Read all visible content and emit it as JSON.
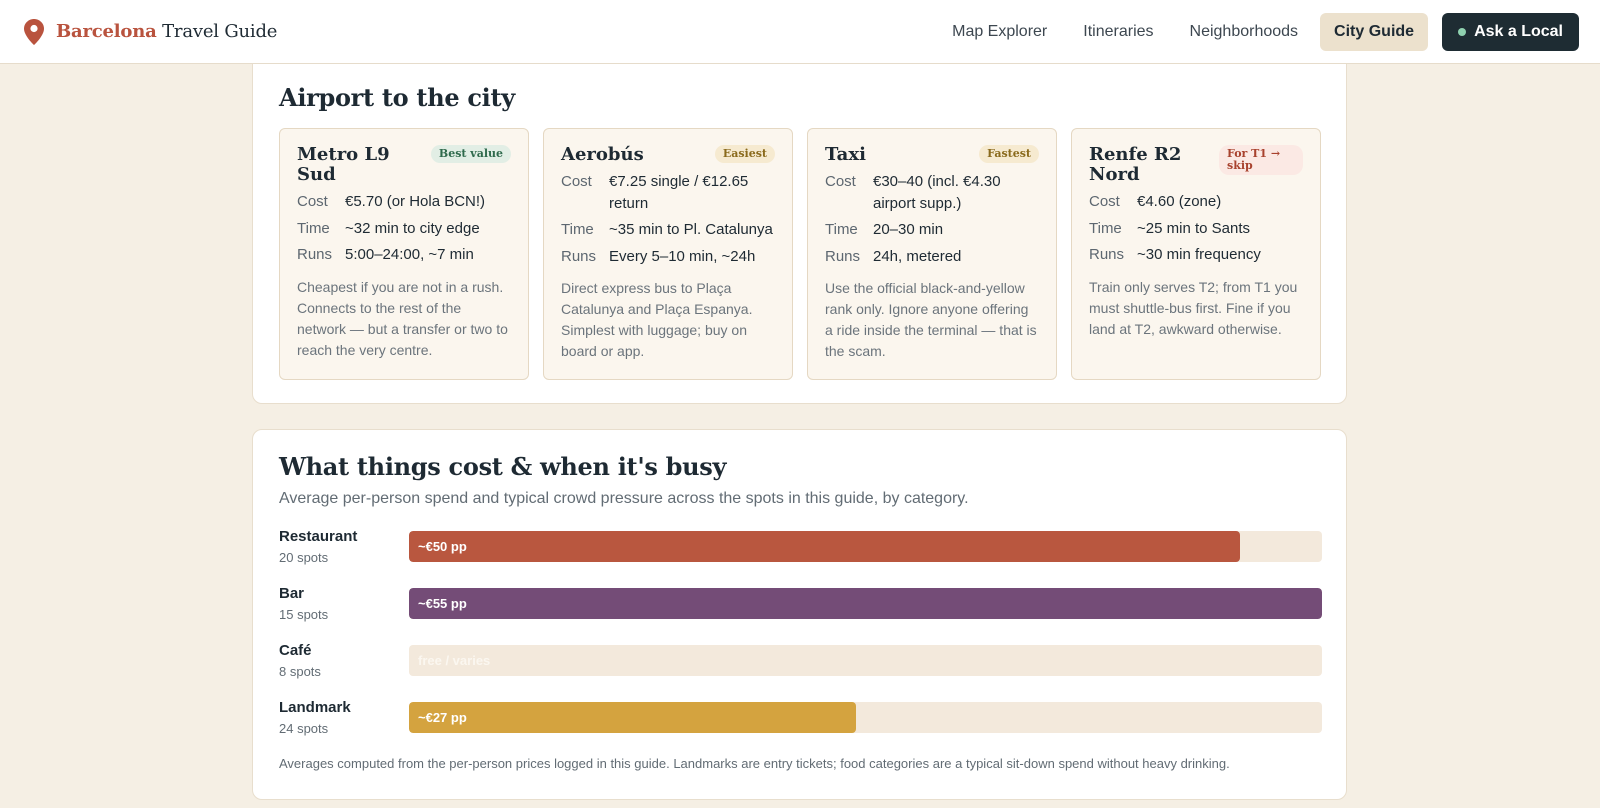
{
  "brand": {
    "accent": "Barcelona",
    "rest": "Travel Guide"
  },
  "nav": {
    "items": [
      {
        "label": "Map Explorer",
        "active": false
      },
      {
        "label": "Itineraries",
        "active": false
      },
      {
        "label": "Neighborhoods",
        "active": false
      },
      {
        "label": "City Guide",
        "active": true
      }
    ],
    "cta": "Ask a Local"
  },
  "airport": {
    "title": "Airport to the city",
    "options": [
      {
        "name": "Metro L9 Sud",
        "badge": "Best value",
        "rows": [
          {
            "key": "Cost",
            "value": "€5.70 (or Hola BCN!)"
          },
          {
            "key": "Time",
            "value": "~32 min to city edge"
          },
          {
            "key": "Runs",
            "value": "5:00–24:00, ~7 min"
          }
        ],
        "desc": "Cheapest if you are not in a rush. Connects to the rest of the network — but a transfer or two to reach the very centre."
      },
      {
        "name": "Aerobús",
        "badge": "Easiest",
        "rows": [
          {
            "key": "Cost",
            "value": "€7.25 single / €12.65 return"
          },
          {
            "key": "Time",
            "value": "~35 min to Pl. Catalunya"
          },
          {
            "key": "Runs",
            "value": "Every 5–10 min, ~24h"
          }
        ],
        "desc": "Direct express bus to Plaça Catalunya and Plaça Espanya. Simplest with luggage; buy on board or app."
      },
      {
        "name": "Taxi",
        "badge": "Fastest",
        "rows": [
          {
            "key": "Cost",
            "value": "€30–40 (incl. €4.30 airport supp.)"
          },
          {
            "key": "Time",
            "value": "20–30 min"
          },
          {
            "key": "Runs",
            "value": "24h, metered"
          }
        ],
        "desc": "Use the official black-and-yellow rank only. Ignore anyone offering a ride inside the terminal — that is the scam."
      },
      {
        "name": "Renfe R2 Nord",
        "badge": "For T1 → skip",
        "rows": [
          {
            "key": "Cost",
            "value": "€4.60 (zone)"
          },
          {
            "key": "Time",
            "value": "~25 min to Sants"
          },
          {
            "key": "Runs",
            "value": "~30 min frequency"
          }
        ],
        "desc": "Train only serves T2; from T1 you must shuttle-bus first. Fine if you land at T2, awkward otherwise."
      }
    ]
  },
  "cost": {
    "title": "What things cost & when it's busy",
    "subtitle": "Average per-person spend and typical crowd pressure across the spots in this guide, by category.",
    "bars": [
      {
        "category": "Restaurant",
        "count": "20 spots",
        "label": "~€50 pp",
        "fill": 0.91,
        "color": "#b9573f"
      },
      {
        "category": "Bar",
        "count": "15 spots",
        "label": "~€55 pp",
        "fill": 1.0,
        "color": "#744c77"
      },
      {
        "category": "Café",
        "count": "8 spots",
        "label": "free / varies",
        "fill": 0,
        "color": "#f3e9dc"
      },
      {
        "category": "Landmark",
        "count": "24 spots",
        "label": "~€27 pp",
        "fill": 0.49,
        "color": "#d4a33f"
      }
    ],
    "footnote": "Averages computed from the per-person prices logged in this guide. Landmarks are entry tickets; food categories are a typical sit-down spend without heavy drinking."
  }
}
